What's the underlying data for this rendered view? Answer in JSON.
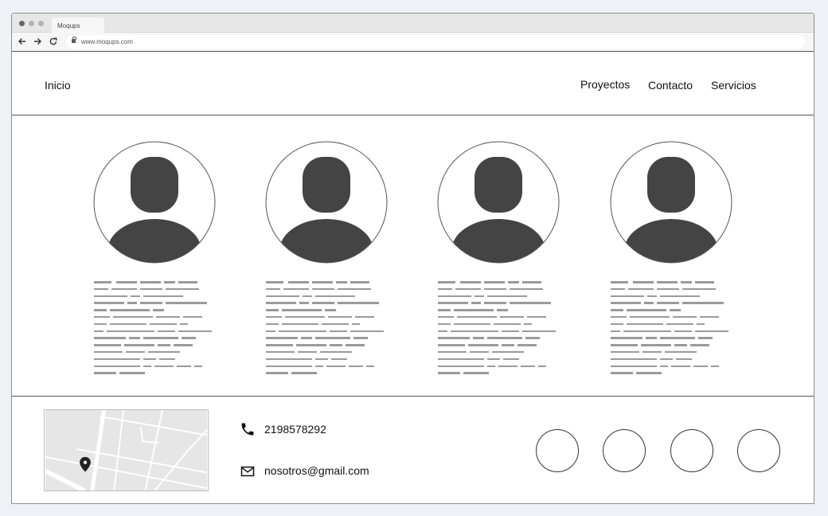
{
  "browser": {
    "tab_title": "Moqups",
    "url": "www.moqups.com",
    "traffic_lights": [
      "#666666",
      "#b3b3b3",
      "#b3b3b3"
    ]
  },
  "nav": {
    "home": "Inicio",
    "links": [
      "Proyectos",
      "Contacto",
      "Servicios"
    ]
  },
  "team": {
    "member_count": 4,
    "avatar_icon": "person-placeholder-icon",
    "bio_text_placeholder": true
  },
  "footer": {
    "phone": "2198578292",
    "email": "nosotros@gmail.com",
    "phone_icon": "phone-icon",
    "email_icon": "envelope-icon",
    "map_icon": "location-pin-icon",
    "social_count": 4
  },
  "colors": {
    "text": "#111111",
    "avatar_fill": "#444444",
    "placeholder_text": "#9a9a9a",
    "border": "#555555",
    "map_bg": "#e6e6e6"
  }
}
